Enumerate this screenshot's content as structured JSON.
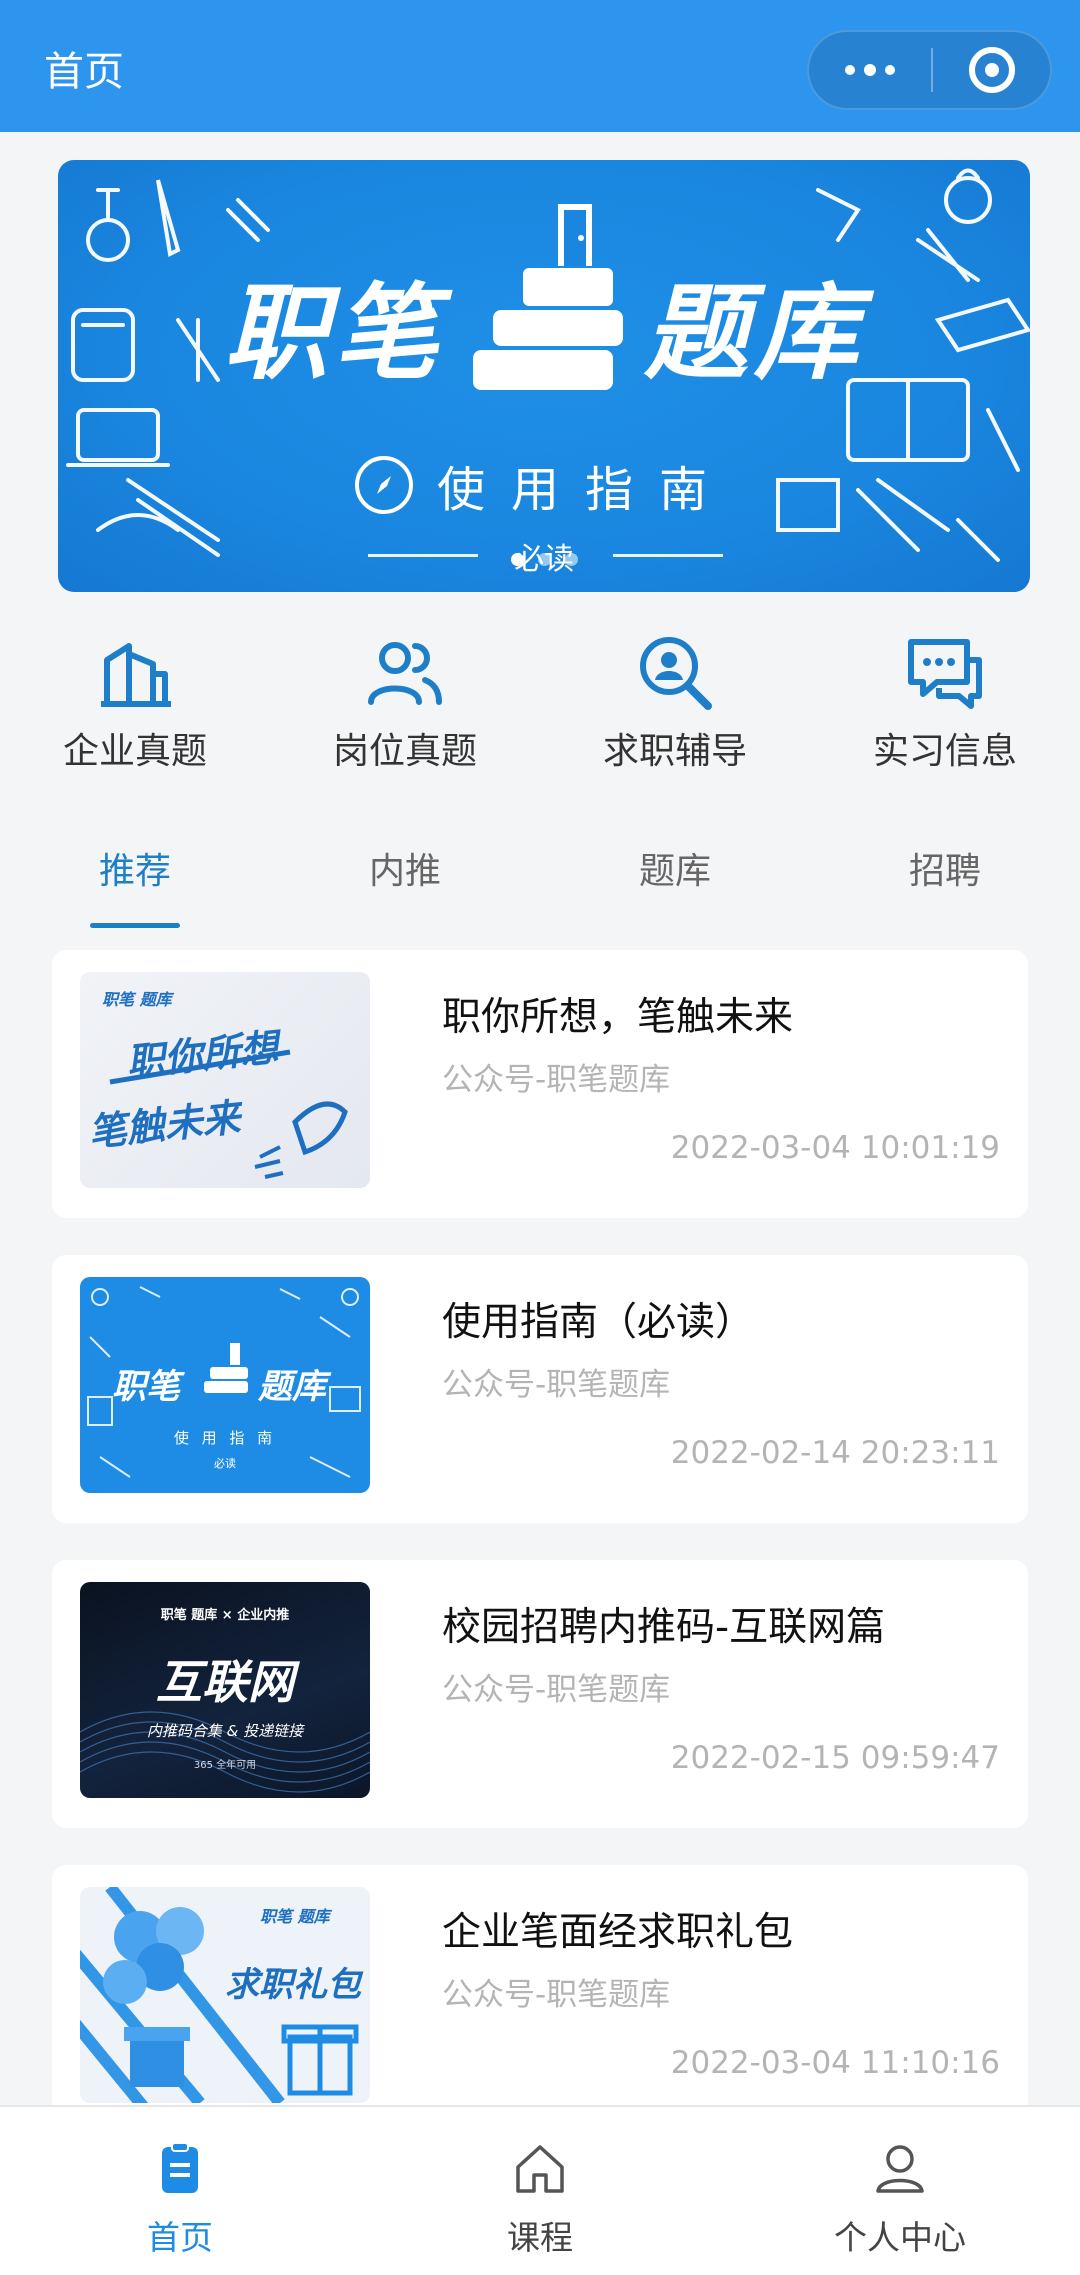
{
  "navbar": {
    "title": "首页"
  },
  "banner": {
    "title_left": "职笔",
    "title_right": "题库",
    "guide": "使用指南",
    "must_read": "必读",
    "slides": 3,
    "active_slide": 0
  },
  "quick_entries": [
    {
      "label": "企业真题",
      "icon": "building-icon"
    },
    {
      "label": "岗位真题",
      "icon": "users-icon"
    },
    {
      "label": "求职辅导",
      "icon": "search-person-icon"
    },
    {
      "label": "实习信息",
      "icon": "chat-icon"
    }
  ],
  "tabs": [
    {
      "label": "推荐",
      "active": true
    },
    {
      "label": "内推",
      "active": false
    },
    {
      "label": "题库",
      "active": false
    },
    {
      "label": "招聘",
      "active": false
    }
  ],
  "articles": [
    {
      "title": "职你所想，笔触未来",
      "source": "公众号-职笔题库",
      "time": "2022-03-04 10:01:19",
      "thumb": {
        "logo": "职笔 题库",
        "line1": "职你所想",
        "line2": "笔触未来"
      }
    },
    {
      "title": "使用指南（必读）",
      "source": "公众号-职笔题库",
      "time": "2022-02-14 20:23:11",
      "thumb": {
        "line1": "职笔",
        "line2": "题库",
        "sub": "使 用 指 南",
        "note": "必读"
      }
    },
    {
      "title": "校园招聘内推码-互联网篇",
      "source": "公众号-职笔题库",
      "time": "2022-02-15 09:59:47",
      "thumb": {
        "logo": "职笔 题库 × 企业内推",
        "line1": "互联网",
        "line2": "内推码合集 & 投递链接",
        "note": "365 全年可用"
      }
    },
    {
      "title": "企业笔面经求职礼包",
      "source": "公众号-职笔题库",
      "time": "2022-03-04 11:10:16",
      "thumb": {
        "logo": "职笔 题库",
        "line1": "求职礼包"
      }
    }
  ],
  "tabbar": [
    {
      "label": "首页",
      "icon": "document-icon",
      "active": true
    },
    {
      "label": "课程",
      "icon": "home-icon",
      "active": false
    },
    {
      "label": "个人中心",
      "icon": "user-icon",
      "active": false
    }
  ],
  "colors": {
    "primary": "#2d95ee",
    "accent": "#1e7fc8",
    "muted": "#b4b4b4"
  }
}
